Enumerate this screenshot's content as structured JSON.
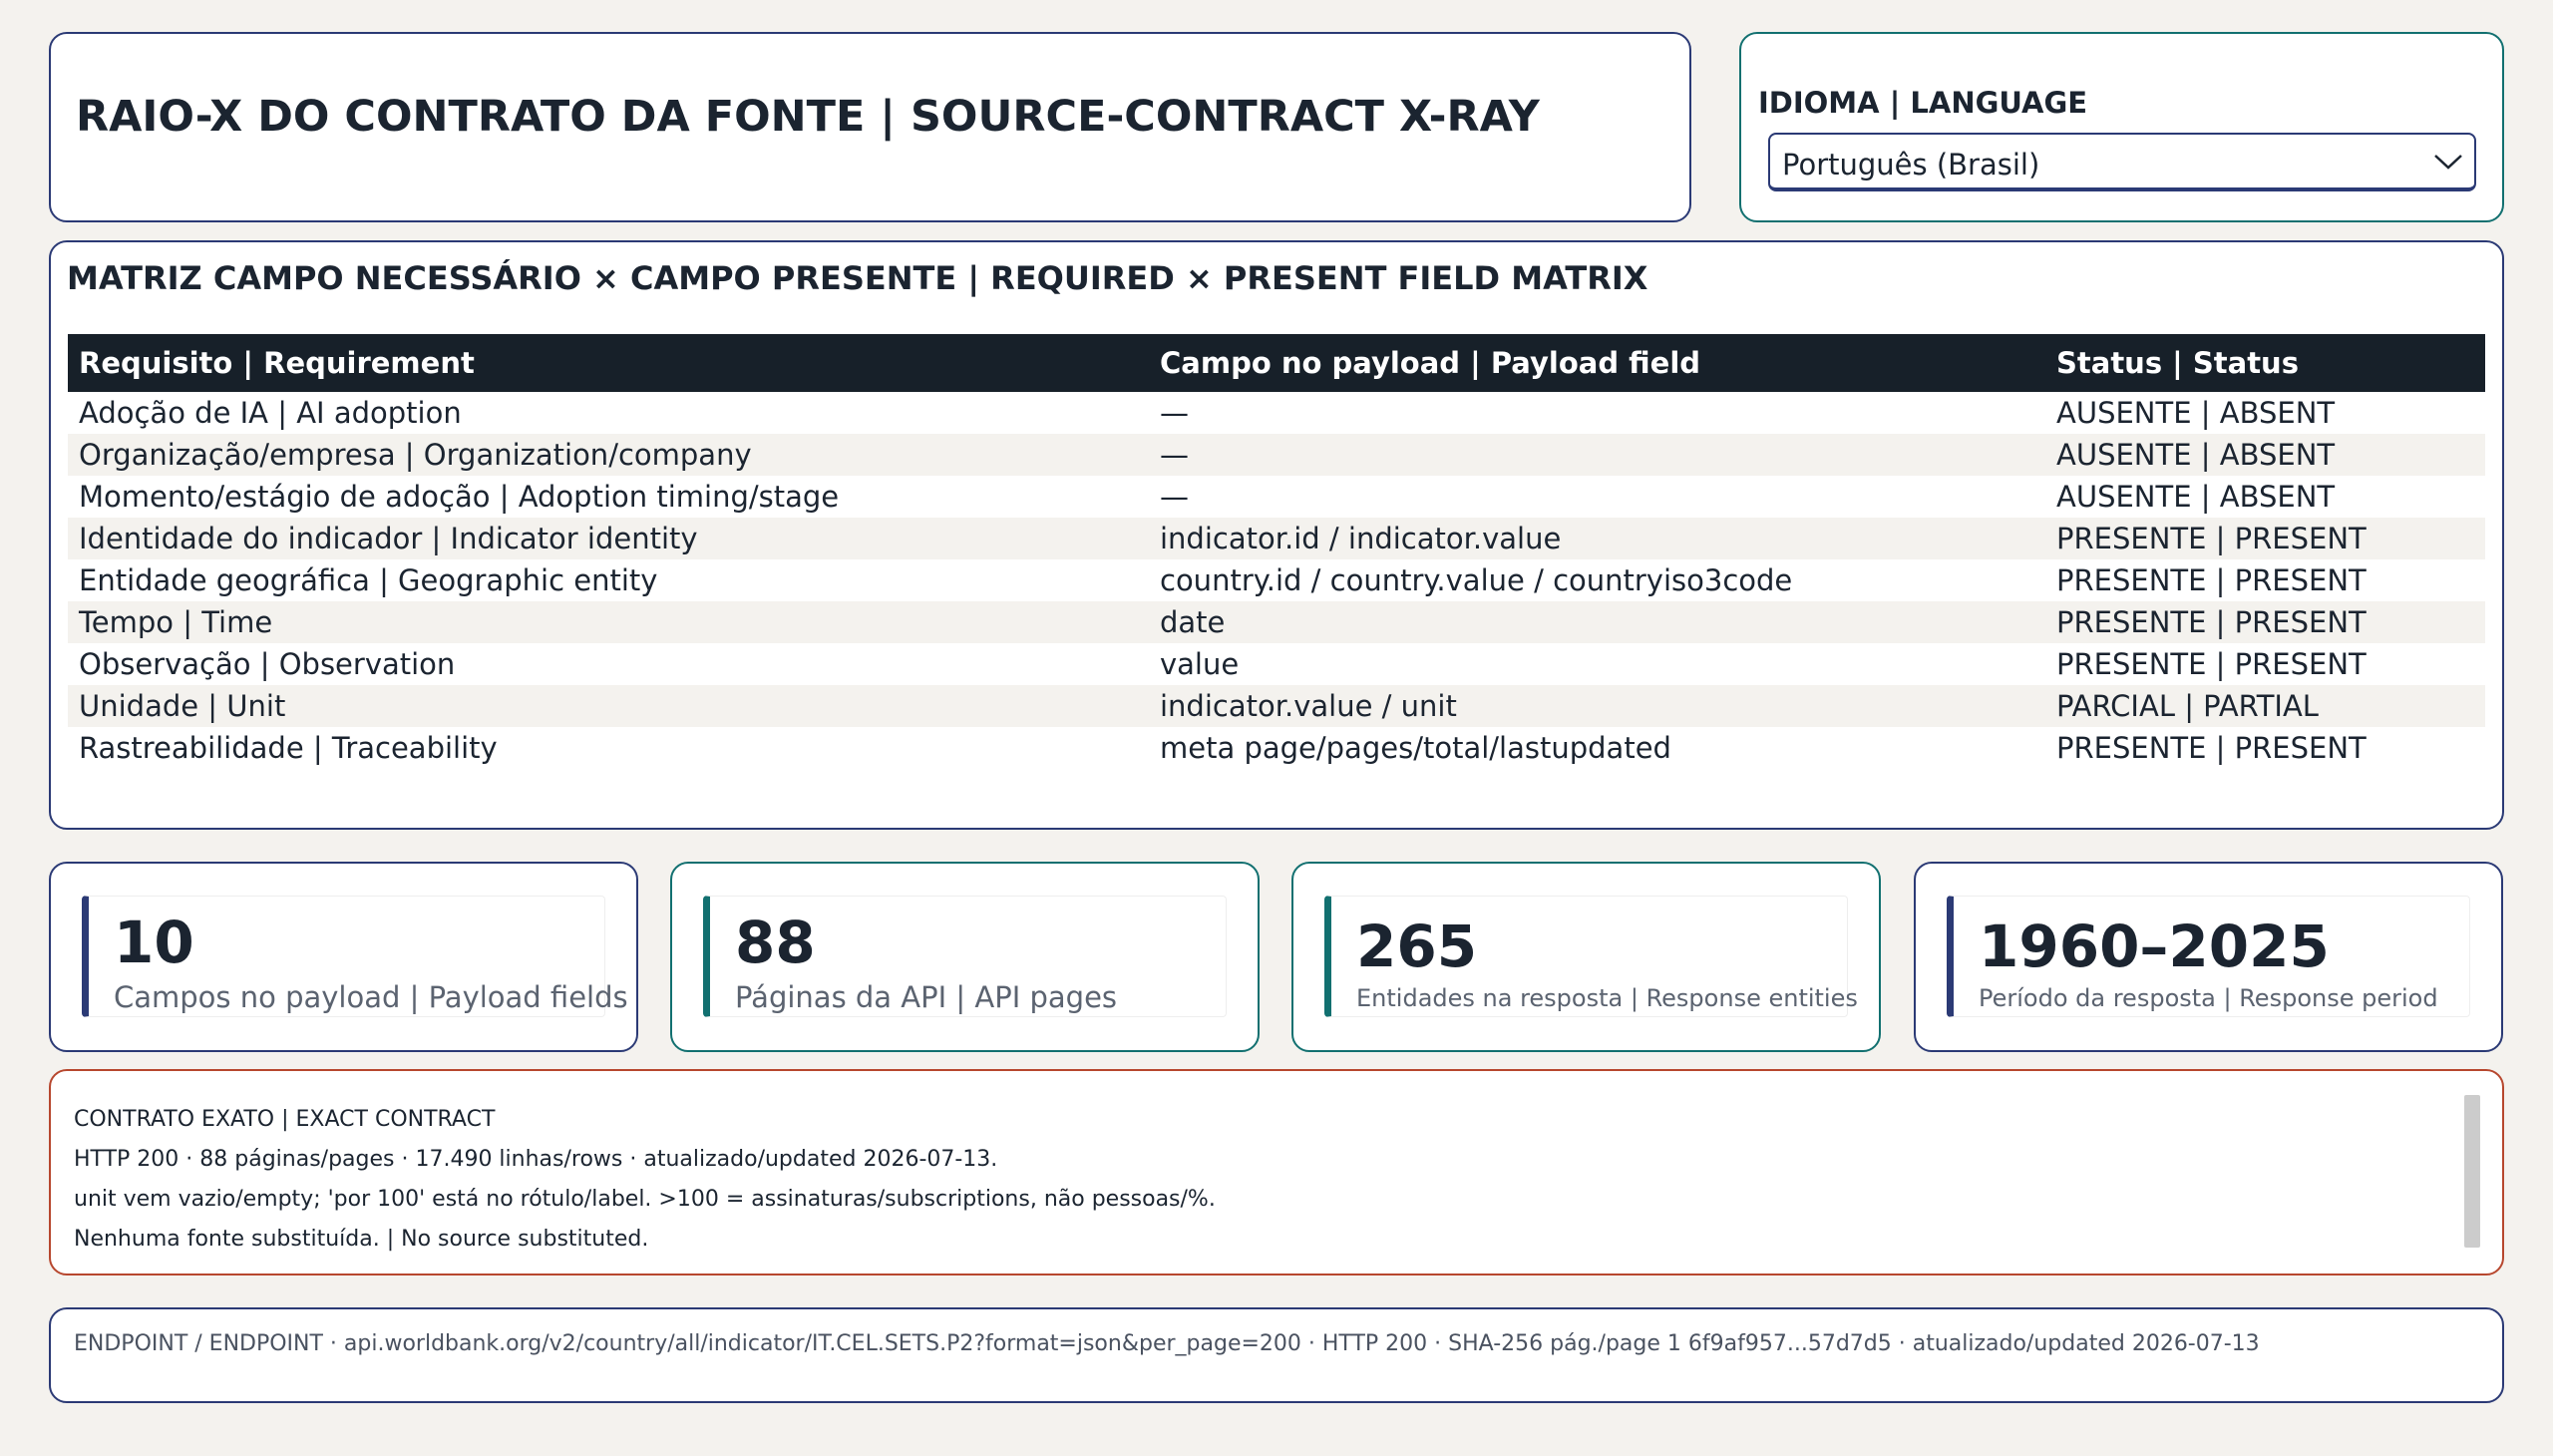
{
  "header": {
    "title": "RAIO-X DO CONTRATO DA FONTE | SOURCE-CONTRACT X-RAY"
  },
  "language": {
    "label": "IDIOMA | LANGUAGE",
    "selected": "Português (Brasil)"
  },
  "matrix": {
    "title": "MATRIZ CAMPO NECESSÁRIO × CAMPO PRESENTE | REQUIRED × PRESENT FIELD MATRIX",
    "columns": [
      "Requisito | Requirement",
      "Campo no payload | Payload field",
      "Status | Status"
    ],
    "rows": [
      [
        "Adoção de IA | AI adoption",
        "—",
        "AUSENTE | ABSENT"
      ],
      [
        "Organização/empresa | Organization/company",
        "—",
        "AUSENTE | ABSENT"
      ],
      [
        "Momento/estágio de adoção | Adoption timing/stage",
        "—",
        "AUSENTE | ABSENT"
      ],
      [
        "Identidade do indicador | Indicator identity",
        "indicator.id / indicator.value",
        "PRESENTE | PRESENT"
      ],
      [
        "Entidade geográfica | Geographic entity",
        "country.id / country.value / countryiso3code",
        "PRESENTE | PRESENT"
      ],
      [
        "Tempo | Time",
        "date",
        "PRESENTE | PRESENT"
      ],
      [
        "Observação | Observation",
        "value",
        "PRESENTE | PRESENT"
      ],
      [
        "Unidade | Unit",
        "indicator.value / unit",
        "PARCIAL | PARTIAL"
      ],
      [
        "Rastreabilidade | Traceability",
        "meta page/pages/total/lastupdated",
        "PRESENTE | PRESENT"
      ]
    ]
  },
  "kpis": [
    {
      "value": "10",
      "caption": "Campos no payload | Payload fields"
    },
    {
      "value": "88",
      "caption": "Páginas da API | API pages"
    },
    {
      "value": "265",
      "caption": "Entidades na resposta | Response entities"
    },
    {
      "value": "1960–2025",
      "caption": "Período da resposta | Response period"
    }
  ],
  "contract": {
    "lines": [
      "CONTRATO EXATO | EXACT CONTRACT",
      "HTTP 200 · 88 páginas/pages · 17.490 linhas/rows · atualizado/updated 2026-07-13.",
      "unit vem vazio/empty; 'por 100' está no rótulo/label. >100 = assinaturas/subscriptions, não pessoas/%.",
      "Nenhuma fonte substituída. | No source substituted."
    ]
  },
  "endpoint": {
    "text": "ENDPOINT / ENDPOINT · api.worldbank.org/v2/country/all/indicator/IT.CEL.SETS.P2?format=json&per_page=200 · HTTP 200 · SHA-256 pág./page 1 6f9af957...57d7d5 · atualizado/updated 2026-07-13"
  },
  "colors": {
    "navy": "#2b3a75",
    "teal": "#127070",
    "rust": "#b7472e",
    "header_dark": "#172029"
  }
}
